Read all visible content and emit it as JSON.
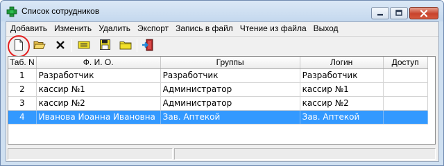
{
  "window": {
    "title": "Список сотрудников"
  },
  "menu": [
    {
      "label": "Добавить"
    },
    {
      "label": "Изменить"
    },
    {
      "label": "Удалить"
    },
    {
      "label": "Экспорт"
    },
    {
      "label": "Запись в файл"
    },
    {
      "label": "Чтение из файла"
    },
    {
      "label": "Выход"
    }
  ],
  "toolbar": {
    "buttons": [
      "new-document-icon",
      "open-folder-icon",
      "delete-x-icon",
      "edit-yellow-icon",
      "save-floppy-icon",
      "folder-yellow-icon",
      "exit-door-icon"
    ],
    "highlighted": "new-document-icon"
  },
  "table": {
    "columns": [
      "Таб. N",
      "Ф. И. О.",
      "Группы",
      "Логин",
      "Доступ"
    ],
    "rows": [
      {
        "tab": "1",
        "name": "Разработчик",
        "group": "Разработчик",
        "login": "Разработчик",
        "access": ""
      },
      {
        "tab": "2",
        "name": "кассир №1",
        "group": "Администратор",
        "login": "кассир №1",
        "access": ""
      },
      {
        "tab": "3",
        "name": "кассир №2",
        "group": "Администратор",
        "login": "кассир №2",
        "access": ""
      },
      {
        "tab": "4",
        "name": "Иванова Иоанна Ивановна",
        "group": "Зав. Аптекой",
        "login": "Зав. Аптекой",
        "access": ""
      }
    ],
    "selected_row": 4
  },
  "colors": {
    "selection": "#3399ff",
    "highlight_ring": "#e22020",
    "close_button": "#c8432c"
  }
}
